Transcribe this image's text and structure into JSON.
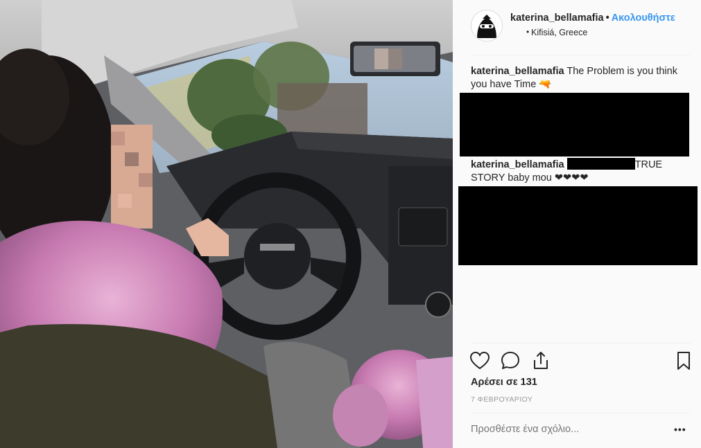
{
  "post": {
    "username": "katerina_bellamafia",
    "separator": "•",
    "follow_label": "Ακολουθήστε",
    "location_bullet": "•",
    "location": "Kifisiá, Greece"
  },
  "comments": [
    {
      "username": "katerina_bellamafia",
      "text": "The Problem is you think you have Time 🔫"
    },
    {
      "username": "katerina_bellamafia",
      "text": "TRUE STORY baby mou ❤❤❤❤"
    }
  ],
  "footer": {
    "likes": "Αρέσει σε 131",
    "date": "7 ΦΕΒΡΟΥΑΡΙΟΥ",
    "comment_placeholder": "Προσθέστε ένα σχόλιο...",
    "more": "•••"
  },
  "icons": {
    "like": "heart-icon",
    "comment": "comment-bubble-icon",
    "share": "share-icon",
    "save": "bookmark-icon",
    "avatar": "masked-face-avatar"
  },
  "colors": {
    "accent": "#3897f0",
    "text": "#262626",
    "muted": "#999999",
    "panel_bg": "#fafafa",
    "redaction": "#000000"
  }
}
